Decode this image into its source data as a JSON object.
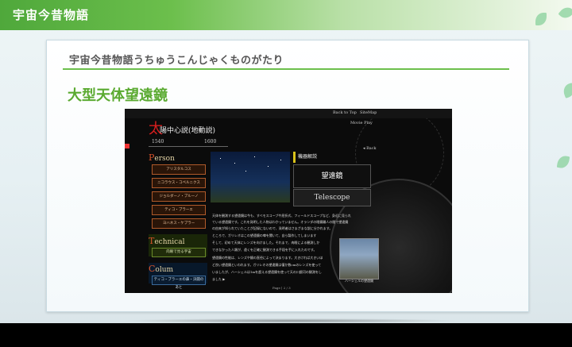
{
  "header": {
    "title": "宇宙今昔物語"
  },
  "panel": {
    "subtitle": "宇宙今昔物語うちゅうこんじゃくものがたり",
    "heading": "大型天体望遠鏡"
  },
  "embedded": {
    "nav": [
      "Back to Top",
      "SiteMap"
    ],
    "movie": "Movie Play",
    "back": "◂ Back",
    "title_first": "太",
    "title_rest": "陽中心説(地動説)",
    "years": [
      "1540",
      "1600"
    ],
    "person": {
      "first": "P",
      "rest": "erson",
      "buttons": [
        "アリスタルコス",
        "ニコラウス・コペルニクス",
        "ジョルダーノ・ブルーノ",
        "ティコ・ブラーエ",
        "ヨハネス・ケプラー"
      ]
    },
    "technical": {
      "first": "T",
      "rest": "echnical",
      "button": "肉眼で見る宇宙"
    },
    "colum": {
      "first": "C",
      "rest": "olum",
      "button": "ティコ・ブラーエの鼻・決闘のあと"
    },
    "machine_label": "機器解説",
    "machine_title": "望遠鏡",
    "machine_sub": "Telescope",
    "paragraphs": [
      "天体を観測する望遠鏡は今も、すべモスコープや屈折式、フィールドスコープなど、身近に見られ",
      "ている望遠鏡です。これを発明した人物はわかっていません。オランダの眼鏡職人の間で望遠鏡",
      "の由来が知られていたことが記録にないので、発明者はさまざまな説に分かれます。",
      "ところで、ガリレオはこの望遠鏡の噂を聞いて、自ら製作してしまいます",
      "そして、初めて天体にレンズを向けました。それまで、肉眼による観測しか",
      "できなかった人類が、遠くを正確に観測できる手段を手に入れたのです。",
      "望遠鏡の性能は、レンズや鏡の直径によって決まります。大きければ大きいほ",
      "ど良い望遠鏡といわれます。ガリレオの望遠鏡は僅か数cmのレンズを使って",
      "いましたが、ハーシェルは1mを超える望遠鏡を使って天の川銀河の観測をし",
      "ました ▶"
    ],
    "photo_caption": "ハーシェルの望遠鏡",
    "pager": "Page | 2 / 3"
  }
}
